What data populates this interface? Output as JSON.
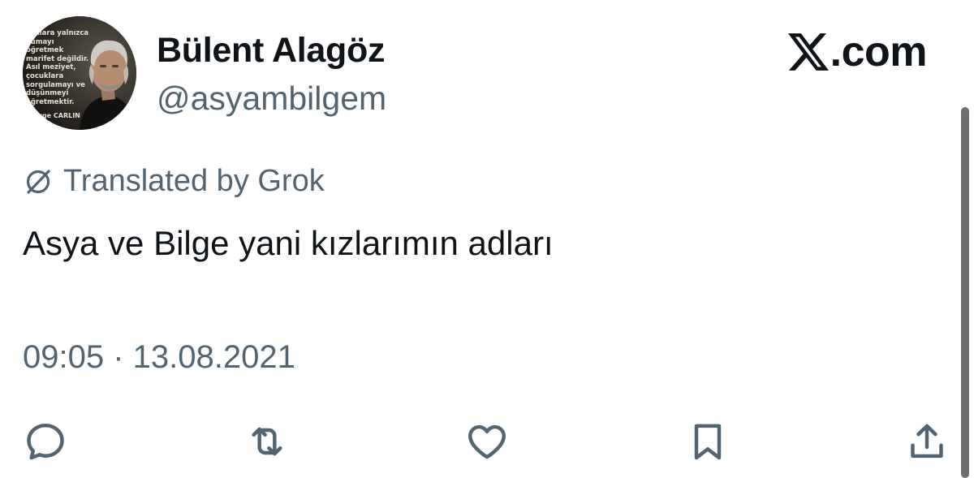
{
  "author": {
    "display_name": "Bülent Alagöz",
    "handle": "@asyambilgem",
    "avatar": {
      "quote_text": "cuklara yalnızca\nkumayı öğretmek\nmarifet değildir.\nAsıl meziyet,\nçocuklara\nsorgulamayı ve\ndüşünmeyi\nöğretmektir.",
      "quote_author": "rge CARLIN"
    }
  },
  "brand": {
    "icon": "x-logo-icon",
    "text": ".com"
  },
  "translation": {
    "icon": "grok-icon",
    "label": "Translated by Grok"
  },
  "tweet": {
    "text": "Asya ve Bilge yani kızlarımın adları",
    "timestamp": "09:05 · 13.08.2021"
  },
  "actions": [
    {
      "name": "reply",
      "icon": "reply-icon"
    },
    {
      "name": "retweet",
      "icon": "retweet-icon"
    },
    {
      "name": "like",
      "icon": "heart-icon"
    },
    {
      "name": "bookmark",
      "icon": "bookmark-icon"
    },
    {
      "name": "share",
      "icon": "share-icon"
    }
  ],
  "colors": {
    "primary_text": "#0f1419",
    "secondary_text": "#536471",
    "background": "#ffffff"
  }
}
